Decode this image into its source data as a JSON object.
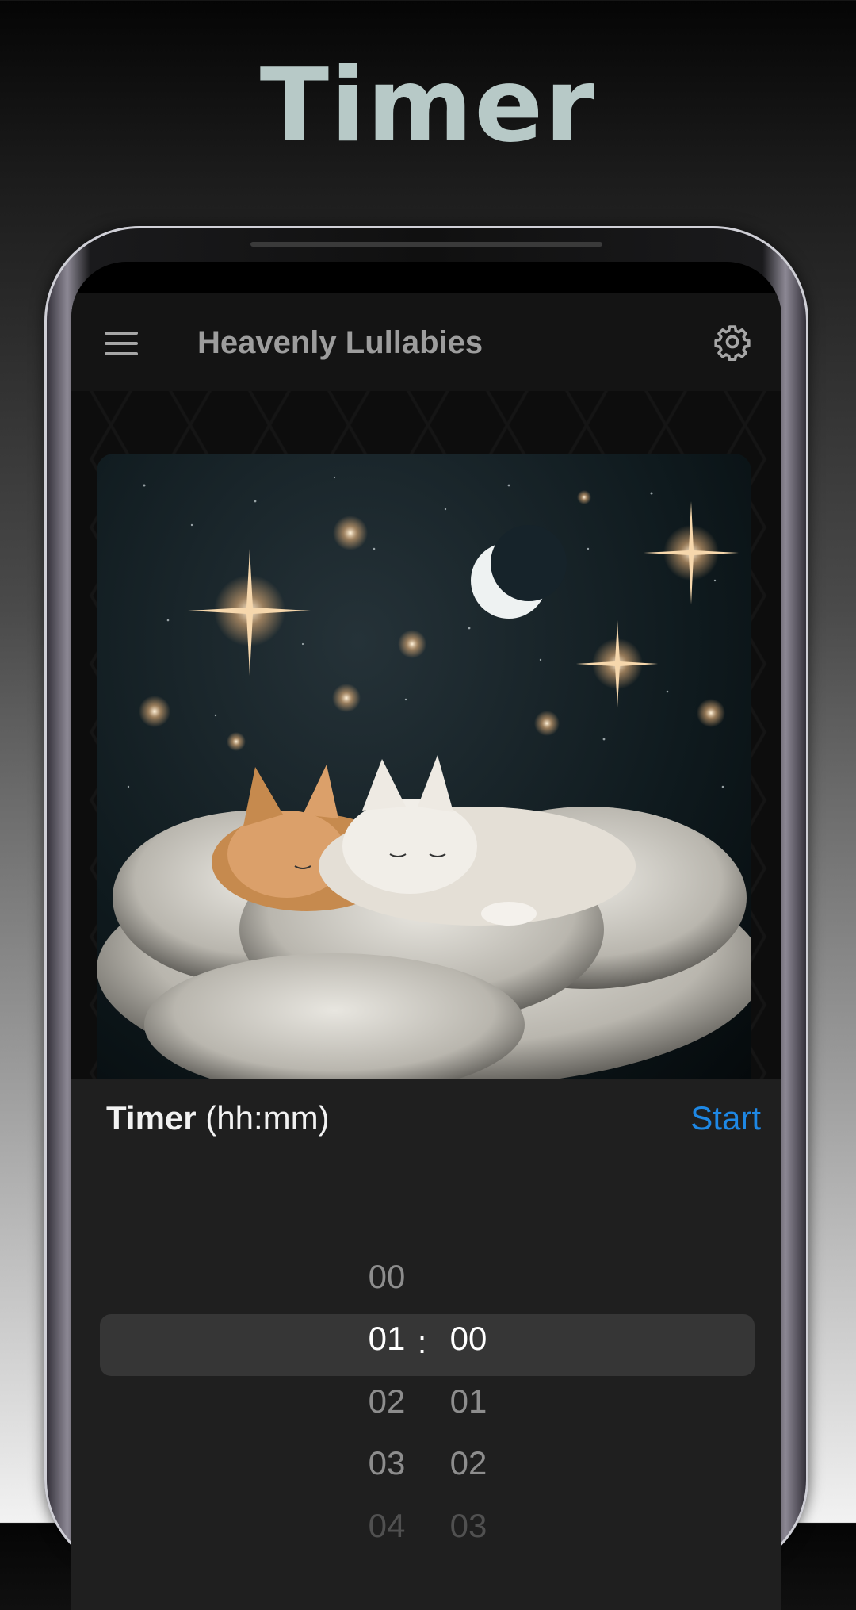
{
  "headline": "Timer",
  "app_bar": {
    "title": "Heavenly Lullabies",
    "menu_icon": "hamburger-menu-icon",
    "settings_icon": "gear-icon"
  },
  "artwork": {
    "subject": "sleeping-kittens-cloud-night-sky"
  },
  "timer": {
    "label_bold": "Timer",
    "label_rest": " (hh:mm)",
    "start_label": "Start",
    "hours": [
      "00",
      "01",
      "02",
      "03",
      "04"
    ],
    "minutes": [
      "00",
      "01",
      "02",
      "03"
    ],
    "selected_hour": "01",
    "selected_minute": "00",
    "separator": ":"
  },
  "colors": {
    "accent": "#1e88e5",
    "headline": "#b7c9c7",
    "panel": "#1f1f1f",
    "appbar": "#141414"
  }
}
